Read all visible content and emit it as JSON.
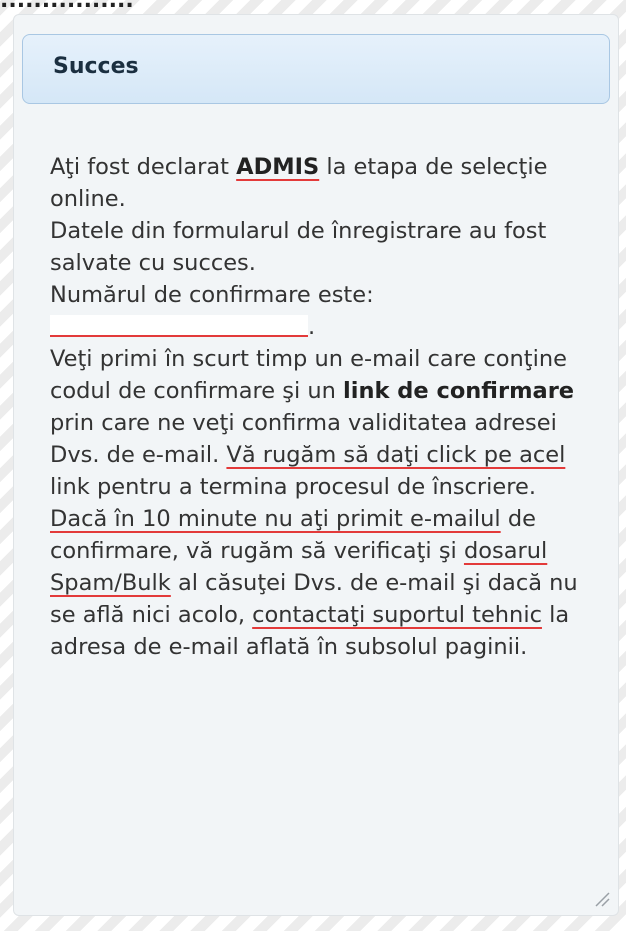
{
  "header": {
    "title": "Succes"
  },
  "message": {
    "l1_before": "Aţi fost declarat ",
    "l1_bold": "ADMIS",
    "l1_after": " la etapa de selecţie online.",
    "l2": "Datele din formularul de înregistrare au fost salvate cu succes.",
    "l3": "Numărul de confirmare este:",
    "l3_end": ".",
    "l4_before": "Veţi primi în scurt timp un e-mail care conţine codul de confirmare şi un ",
    "l4_bold": "link de confirmare",
    "l4_mid": " prin care ne veţi confirma validitatea adresei Dvs. de e-mail. ",
    "l4_under": "Vă rugăm să daţi click pe acel",
    "l4_after": " link pentru a termina procesul de înscriere.",
    "l5_under1": "Dacă în 10 minute nu aţi primit e-mailul",
    "l5_mid1": " de confirmare, vă rugăm să verificaţi şi ",
    "l5_under2": "dosarul Spam/Bulk",
    "l5_mid2": " al căsuţei Dvs. de e-mail şi dacă nu se află nici acolo, ",
    "l5_under3": "contactaţi suportul tehnic",
    "l5_after": " la adresa de e-mail aflată în subsolul paginii."
  }
}
